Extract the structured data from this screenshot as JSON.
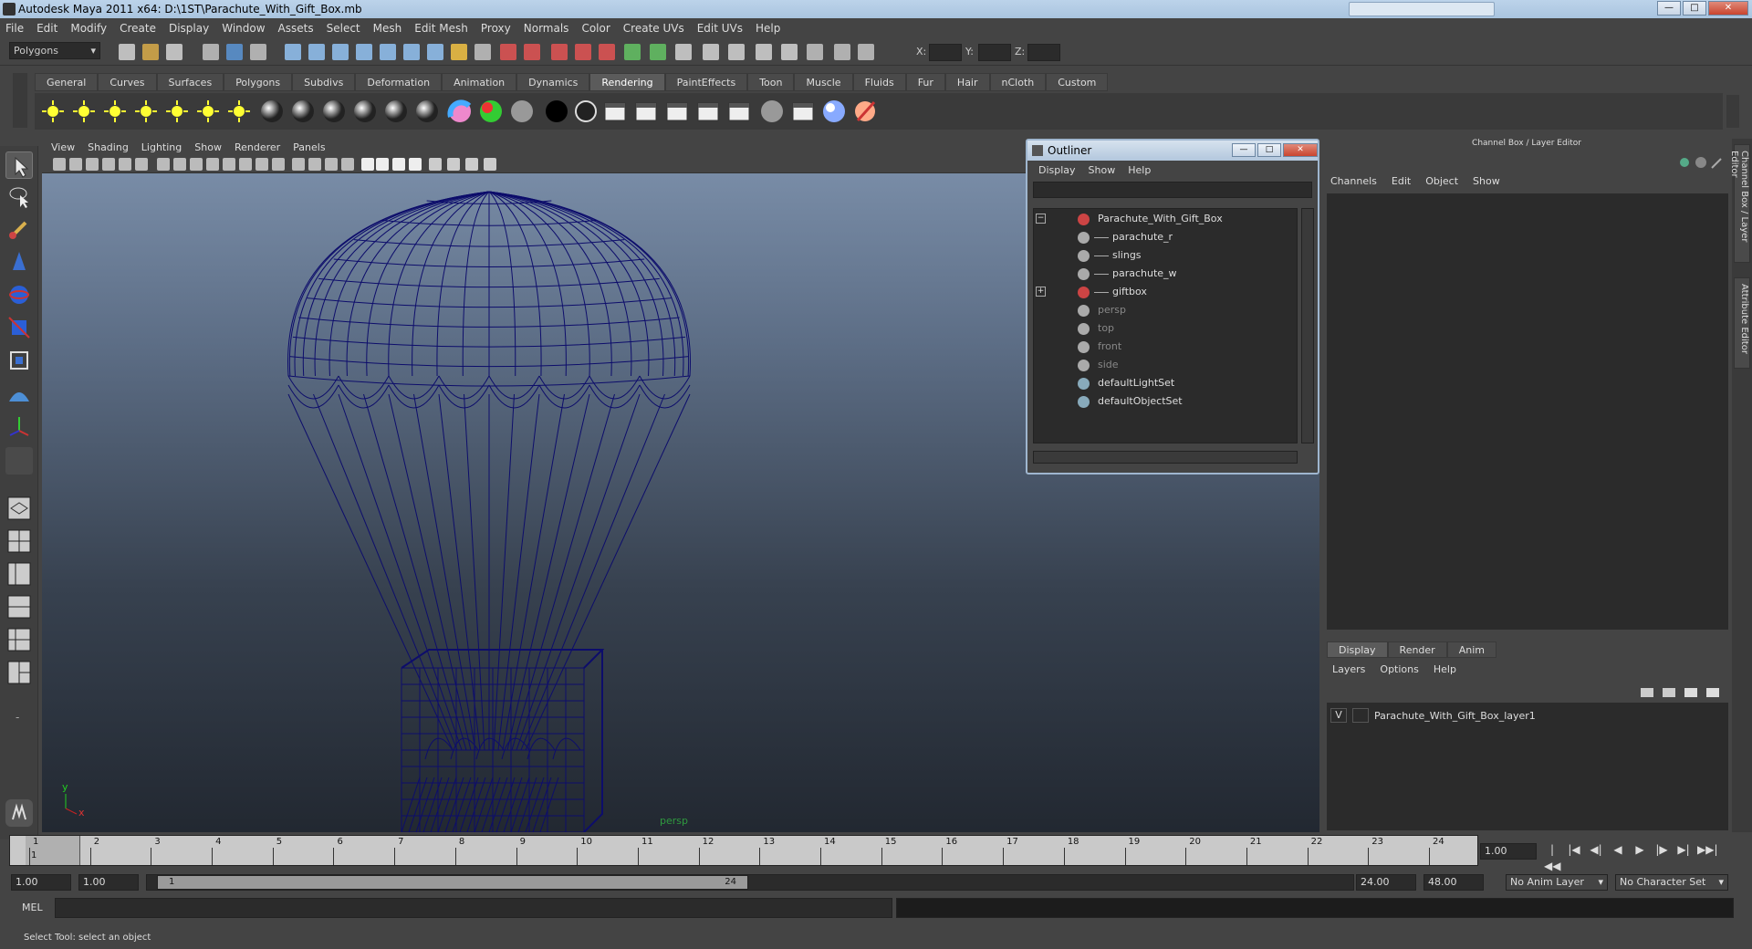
{
  "window": {
    "title": "Autodesk Maya 2011 x64: D:\\1ST\\Parachute_With_Gift_Box.mb",
    "search_placeholder": ""
  },
  "menubar": [
    "File",
    "Edit",
    "Modify",
    "Create",
    "Display",
    "Window",
    "Assets",
    "Select",
    "Mesh",
    "Edit Mesh",
    "Proxy",
    "Normals",
    "Color",
    "Create UVs",
    "Edit UVs",
    "Help"
  ],
  "toolbar": {
    "mode": "Polygons",
    "x_label": "X:",
    "y_label": "Y:",
    "z_label": "Z:"
  },
  "shelf_tabs": [
    "General",
    "Curves",
    "Surfaces",
    "Polygons",
    "Subdivs",
    "Deformation",
    "Animation",
    "Dynamics",
    "Rendering",
    "PaintEffects",
    "Toon",
    "Muscle",
    "Fluids",
    "Fur",
    "Hair",
    "nCloth",
    "Custom"
  ],
  "shelf_active": "Rendering",
  "viewport": {
    "menu": [
      "View",
      "Shading",
      "Lighting",
      "Show",
      "Renderer",
      "Panels"
    ],
    "camera_label": "persp",
    "axis_y": "y",
    "axis_x": "x",
    "wire_color": "#0d0d6b"
  },
  "outliner": {
    "title": "Outliner",
    "menu": [
      "Display",
      "Show",
      "Help"
    ],
    "items": [
      {
        "name": "Parachute_With_Gift_Box",
        "dim": false,
        "expander": "−"
      },
      {
        "name": "parachute_r",
        "dim": false,
        "expander": ""
      },
      {
        "name": "slings",
        "dim": false,
        "expander": ""
      },
      {
        "name": "parachute_w",
        "dim": false,
        "expander": ""
      },
      {
        "name": "giftbox",
        "dim": false,
        "expander": "+"
      },
      {
        "name": "persp",
        "dim": true,
        "expander": ""
      },
      {
        "name": "top",
        "dim": true,
        "expander": ""
      },
      {
        "name": "front",
        "dim": true,
        "expander": ""
      },
      {
        "name": "side",
        "dim": true,
        "expander": ""
      },
      {
        "name": "defaultLightSet",
        "dim": false,
        "expander": ""
      },
      {
        "name": "defaultObjectSet",
        "dim": false,
        "expander": ""
      }
    ]
  },
  "channelbox": {
    "title": "Channel Box / Layer Editor",
    "menu": [
      "Channels",
      "Edit",
      "Object",
      "Show"
    ],
    "layer_tabs": [
      "Display",
      "Render",
      "Anim"
    ],
    "layer_menu": [
      "Layers",
      "Options",
      "Help"
    ],
    "layer": {
      "visible": "V",
      "name": "Parachute_With_Gift_Box_layer1"
    }
  },
  "side_tabs": [
    "Channel Box / Layer Editor",
    "Attribute Editor"
  ],
  "timeline": {
    "ticks": [
      "1",
      "2",
      "3",
      "4",
      "5",
      "6",
      "7",
      "8",
      "9",
      "10",
      "11",
      "12",
      "13",
      "14",
      "15",
      "16",
      "17",
      "18",
      "19",
      "20",
      "21",
      "22",
      "23",
      "24"
    ],
    "current_marker": "1",
    "current_frame": "1.00"
  },
  "range": {
    "start": "1.00",
    "playback_start": "1.00",
    "handle_start": "1",
    "handle_end": "24",
    "playback_end": "24.00",
    "end": "48.00",
    "anim_layer": "No Anim Layer",
    "char_set": "No Character Set"
  },
  "mel": {
    "label": "MEL"
  },
  "helpline": "Select Tool: select an object"
}
